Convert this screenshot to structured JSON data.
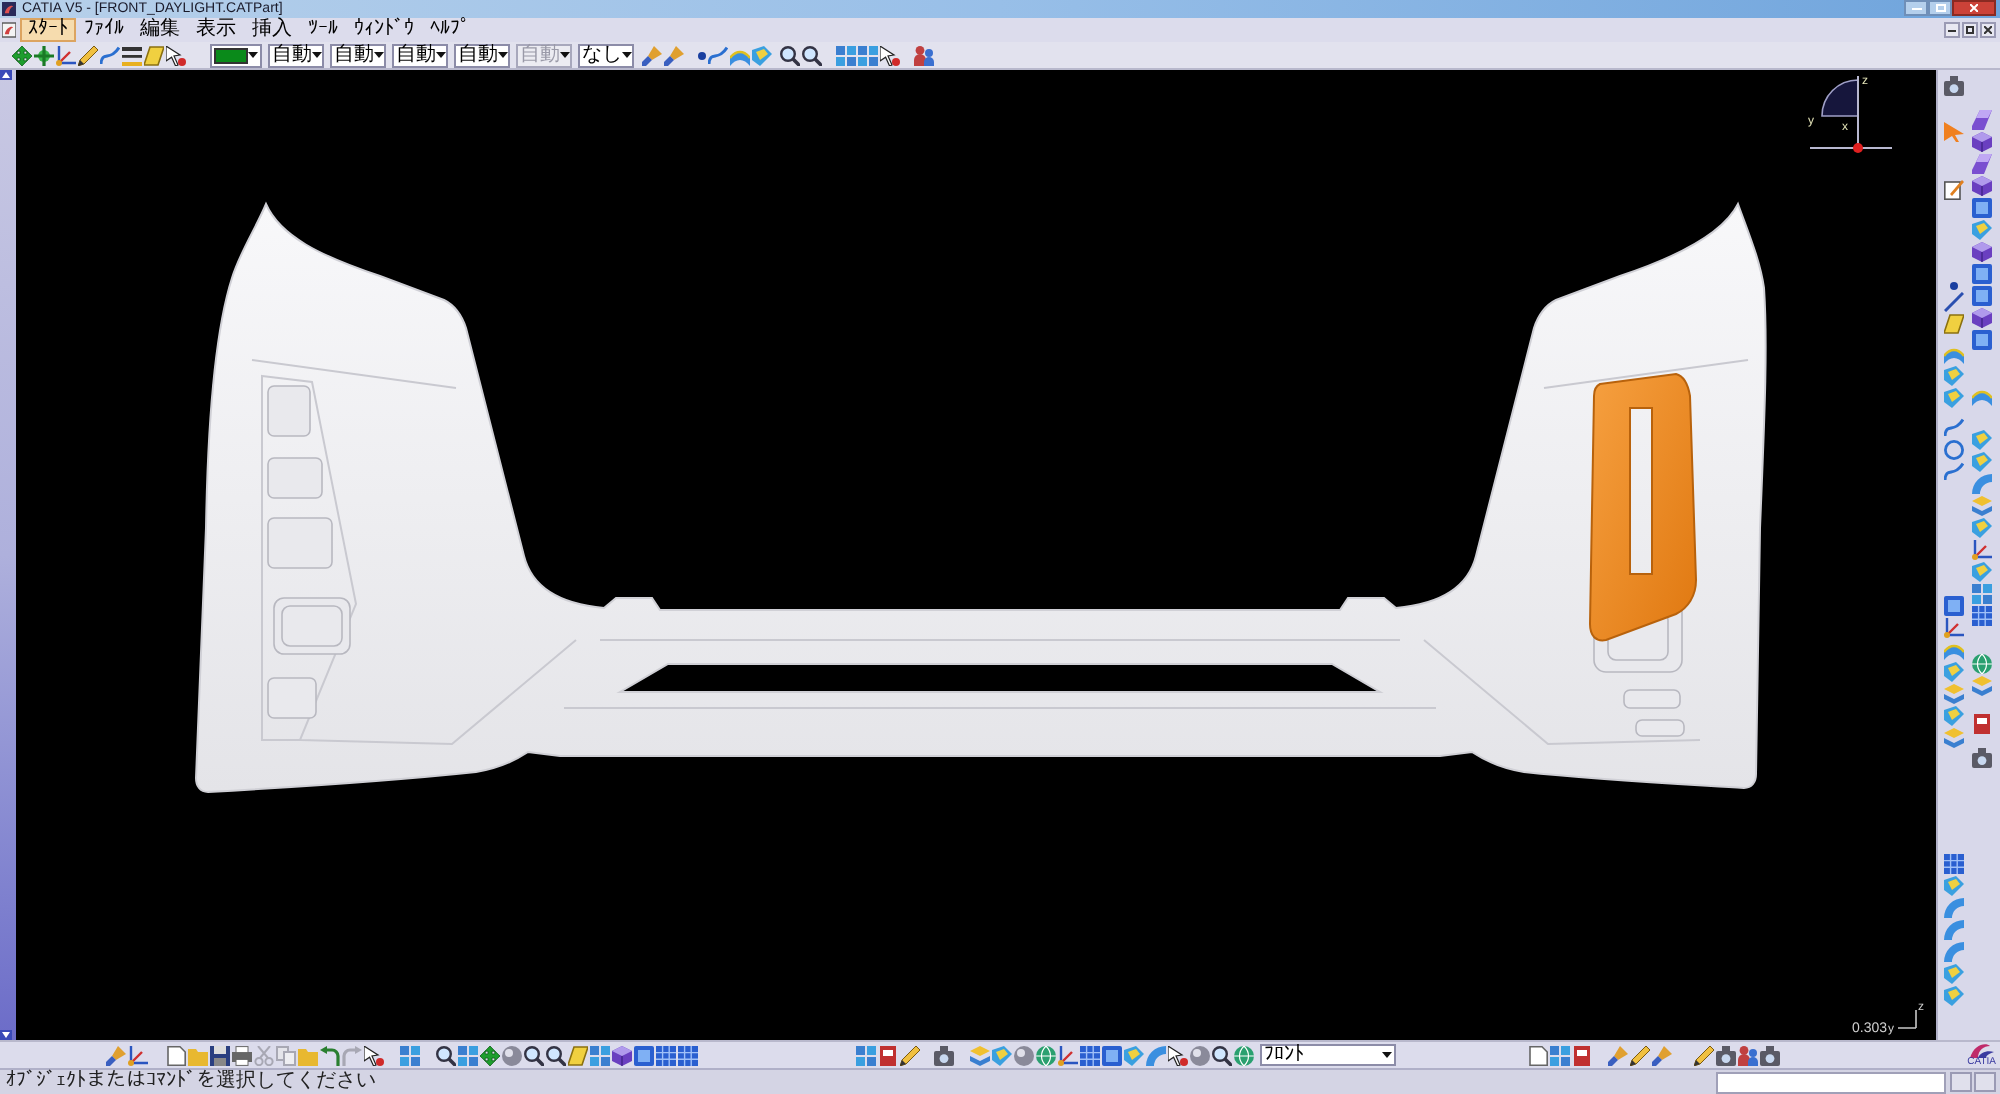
{
  "window": {
    "title": "CATIA V5 - [FRONT_DAYLIGHT.CATPart]"
  },
  "menu_bar": {
    "items": [
      {
        "label": "ｽﾀｰﾄ",
        "selected": true
      },
      {
        "label": "ﾌｧｲﾙ",
        "selected": false
      },
      {
        "label": "編集",
        "selected": false
      },
      {
        "label": "表示",
        "selected": false
      },
      {
        "label": "挿入",
        "selected": false
      },
      {
        "label": "ﾂｰﾙ",
        "selected": false
      },
      {
        "label": "ｳｨﾝﾄﾞｳ",
        "selected": false
      },
      {
        "label": "ﾍﾙﾌﾟ",
        "selected": false
      }
    ]
  },
  "graphic_properties": {
    "dropdowns": [
      {
        "kind": "color",
        "color": "#0a8a1a"
      },
      {
        "kind": "text",
        "value": "自動",
        "disabled": false
      },
      {
        "kind": "text",
        "value": "自動",
        "disabled": false
      },
      {
        "kind": "text",
        "value": "自動",
        "disabled": false
      },
      {
        "kind": "text",
        "value": "自動",
        "disabled": false
      },
      {
        "kind": "text",
        "value": "自動",
        "disabled": true
      },
      {
        "kind": "text",
        "value": "なし",
        "disabled": false
      }
    ]
  },
  "viewport": {
    "compass_labels": [
      "z",
      "y",
      "x"
    ],
    "scale": "0.303",
    "axis_labels": [
      "z",
      "y"
    ]
  },
  "view_toolbar": {
    "view_dropdown": "ﾌﾛﾝﾄ"
  },
  "logo": {
    "text": "CATIA"
  },
  "status_bar": {
    "prompt": "ｵﾌﾞｼﾞｪｸﾄまたはｺﾏﾝﾄﾞを選択してください"
  }
}
